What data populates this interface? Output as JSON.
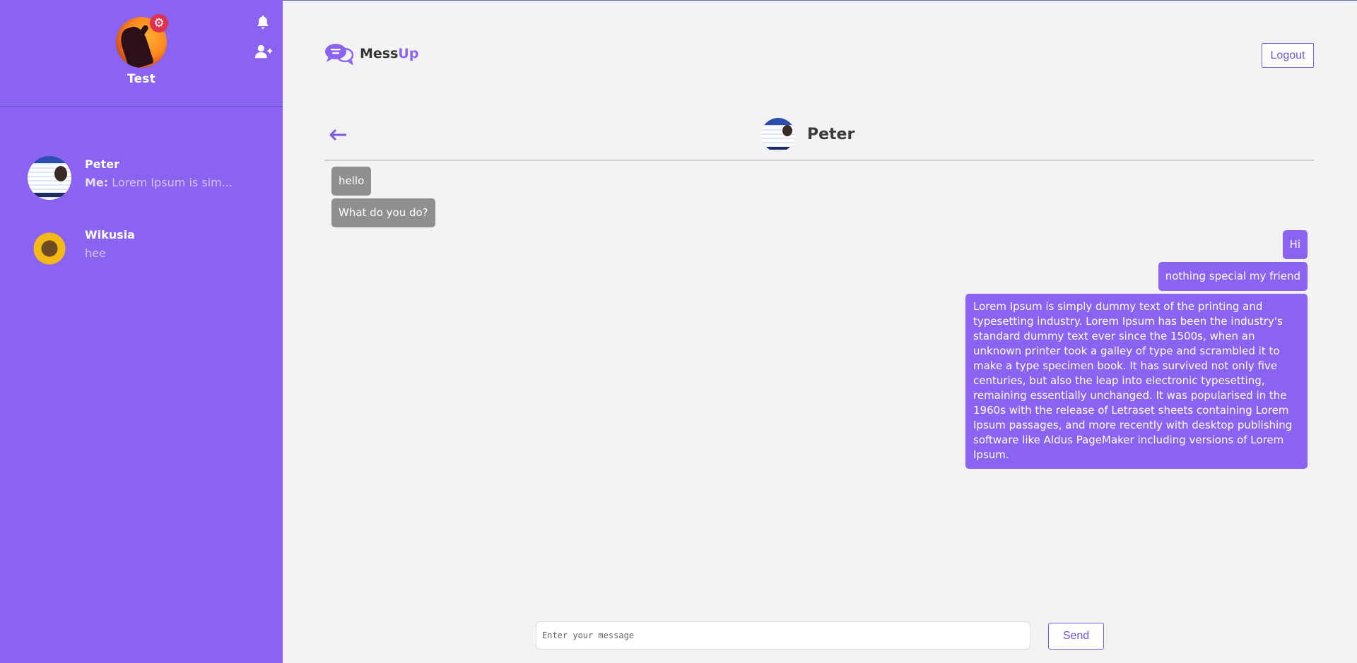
{
  "current_user": {
    "name": "Test"
  },
  "sidebar": {
    "icons": [
      "settings-icon",
      "bell-icon",
      "add-user-icon"
    ],
    "contacts": [
      {
        "name": "Peter",
        "last_prefix": "Me:",
        "last_message": "Lorem Ipsum is sim..."
      },
      {
        "name": "Wikusia",
        "last_prefix": "",
        "last_message": "hee"
      }
    ]
  },
  "header": {
    "logo_part1": "Mess",
    "logo_part2": "Up",
    "logout_label": "Logout"
  },
  "chat": {
    "peer_name": "Peter",
    "messages": [
      {
        "from": "peer",
        "text": "hello"
      },
      {
        "from": "peer",
        "text": "What do you do?"
      },
      {
        "from": "me",
        "text": "Hi"
      },
      {
        "from": "me",
        "text": "nothing special my friend"
      },
      {
        "from": "me",
        "text": "Lorem Ipsum is simply dummy text of the printing and typesetting industry. Lorem Ipsum has been the industry's standard dummy text ever since the 1500s, when an unknown printer took a galley of type and scrambled it to make a type specimen book. It has survived not only five centuries, but also the leap into electronic typesetting, remaining essentially unchanged. It was popularised in the 1960s with the release of Letraset sheets containing Lorem Ipsum passages, and more recently with desktop publishing software like Aldus PageMaker including versions of Lorem Ipsum."
      }
    ]
  },
  "composer": {
    "placeholder": "Enter your message",
    "send_label": "Send"
  },
  "colors": {
    "sidebar_bg": "#8a63f0",
    "accent": "#8a63f0",
    "incoming_bubble": "#8f8f8f",
    "settings_badge": "#e0314f"
  }
}
